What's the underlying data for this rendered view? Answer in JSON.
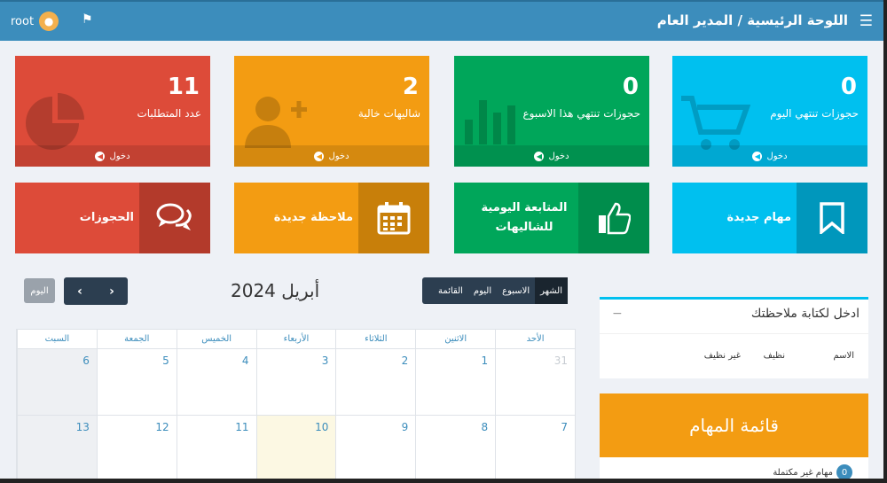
{
  "header": {
    "breadcrumb": "اللوحة الرئيسية / المدير العام",
    "user": "root"
  },
  "stats": [
    {
      "number": "0",
      "label": "حجوزات تنتهي اليوم",
      "link": "دخول",
      "color": "#00c0ef",
      "icon": "cart-icon"
    },
    {
      "number": "0",
      "label": "حجوزات تنتهي هذا الاسبوع",
      "link": "دخول",
      "color": "#00a65a",
      "icon": "bar-chart-icon"
    },
    {
      "number": "2",
      "label": "شاليهات خالية",
      "link": "دخول",
      "color": "#f39c12",
      "icon": "user-plus-icon"
    },
    {
      "number": "11",
      "label": "عدد المتطلبات",
      "link": "دخول",
      "color": "#dd4b39",
      "icon": "pie-chart-icon"
    }
  ],
  "shortcuts": [
    {
      "label": "مهام جديدة",
      "color": "#00c0ef",
      "dark": "#0097bc",
      "icon": "bookmark-icon"
    },
    {
      "label": "المتابعة اليومية للشاليهات",
      "color": "#00a65a",
      "dark": "#008d4c",
      "icon": "thumbs-up-icon"
    },
    {
      "label": "ملاحظة جديدة",
      "color": "#f39c12",
      "dark": "#c87f0a",
      "icon": "calendar-icon"
    },
    {
      "label": "الحجوزات",
      "color": "#dd4b39",
      "dark": "#b33a2b",
      "icon": "chat-icon"
    }
  ],
  "calendar": {
    "title": "أبريل 2024",
    "today_button": "اليوم",
    "prev": "‹",
    "next": "›",
    "views": [
      "الشهر",
      "الاسبوع",
      "اليوم",
      "القائمة"
    ],
    "days": [
      "الأحد",
      "الاثنين",
      "الثلاثاء",
      "الأربعاء",
      "الخميس",
      "الجمعة",
      "السبت"
    ],
    "week1": [
      "31",
      "1",
      "2",
      "3",
      "4",
      "5",
      "6"
    ],
    "week2": [
      "7",
      "8",
      "9",
      "10",
      "11",
      "12",
      "13"
    ]
  },
  "notes": {
    "title": "ادخل لكتابة ملاحظتك",
    "collapse": "−",
    "columns": [
      "الاسم",
      "نظيف",
      "غير نظيف"
    ]
  },
  "tasks": {
    "title": "قائمة المهام",
    "count": "0",
    "label": "مهام غير مكتملة"
  }
}
